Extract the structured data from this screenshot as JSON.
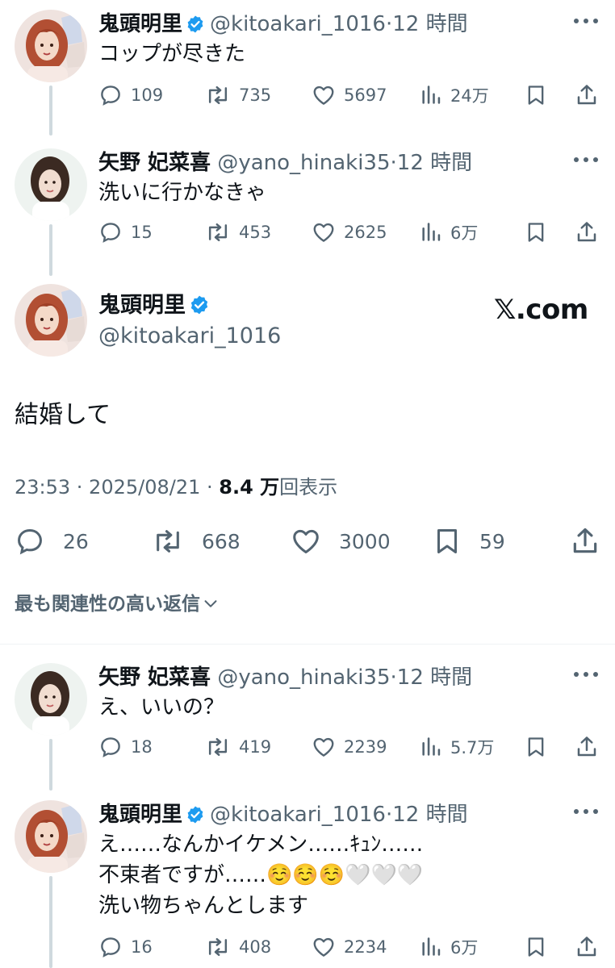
{
  "tweets": [
    {
      "name": "鬼頭明里",
      "handle": "@kitoakari_1016",
      "dot": "·",
      "time": "12 時間",
      "verified": true,
      "text": [
        "コップが尽きた"
      ],
      "replies": "109",
      "retweets": "735",
      "likes": "5697",
      "views": "24万"
    },
    {
      "name": "矢野 妃菜喜",
      "handle": "@yano_hinaki35",
      "dot": "·",
      "time": "12 時間",
      "verified": false,
      "text": [
        "洗いに行かなきゃ"
      ],
      "replies": "15",
      "retweets": "453",
      "likes": "2625",
      "views": "6万"
    }
  ],
  "main": {
    "name": "鬼頭明里",
    "handle": "@kitoakari_1016",
    "watermark": "𝕏.com",
    "text": "結婚して",
    "time": "23:53 · 2025/08/21 · ",
    "views_count": "8.4 万",
    "views_label": "回表示",
    "replies": "26",
    "retweets": "668",
    "likes": "3000",
    "bookmarks": "59"
  },
  "relevance_label": "最も関連性の高い返信",
  "replies": [
    {
      "name": "矢野 妃菜喜",
      "handle": "@yano_hinaki35",
      "dot": "·",
      "time": "12 時間",
      "verified": false,
      "text": [
        "え、いいの？"
      ],
      "replies": "18",
      "retweets": "419",
      "likes": "2239",
      "views": "5.7万"
    },
    {
      "name": "鬼頭明里",
      "handle": "@kitoakari_1016",
      "dot": "·",
      "time": "12 時間",
      "verified": true,
      "text": [
        "え……なんかイケメン……ｷｭﾝ……",
        "不束者ですが……☺️☺️☺️🤍🤍🤍",
        "洗い物ちゃんとします"
      ],
      "replies": "16",
      "retweets": "408",
      "likes": "2234",
      "views": "6万"
    }
  ],
  "colors": {
    "text": "#0f1419",
    "secondary": "#536471",
    "verified": "#1d9bf0",
    "thread_line": "#cfd9de"
  },
  "icons": [
    "reply-icon",
    "retweet-icon",
    "like-icon",
    "views-icon",
    "bookmark-icon",
    "share-icon",
    "more-icon",
    "verified-icon",
    "chevron-down-icon"
  ]
}
